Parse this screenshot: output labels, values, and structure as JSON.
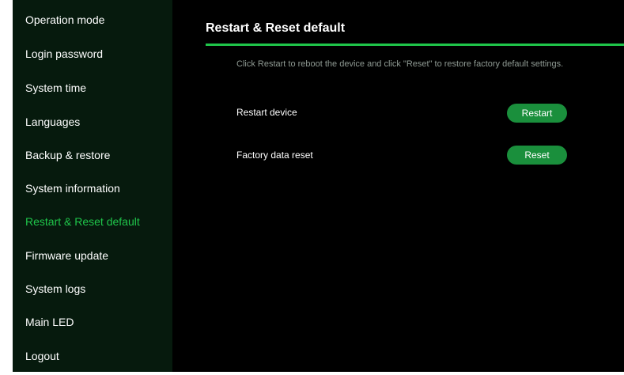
{
  "sidebar": {
    "items": [
      {
        "label": "Operation mode"
      },
      {
        "label": "Login password"
      },
      {
        "label": "System time"
      },
      {
        "label": "Languages"
      },
      {
        "label": "Backup & restore"
      },
      {
        "label": "System information"
      },
      {
        "label": "Restart & Reset default",
        "active": true
      },
      {
        "label": "Firmware update"
      },
      {
        "label": "System logs"
      },
      {
        "label": "Main LED"
      },
      {
        "label": "Logout"
      }
    ]
  },
  "main": {
    "title": "Restart & Reset default",
    "description": "Click Restart to reboot the device and click \"Reset\" to restore factory default settings.",
    "restart": {
      "label": "Restart device",
      "button": "Restart"
    },
    "reset": {
      "label": "Factory data reset",
      "button": "Reset"
    }
  },
  "colors": {
    "accent": "#1fc54a",
    "button": "#1a8f3c",
    "sidebar_bg": "#061a0d",
    "main_bg": "#000000"
  }
}
